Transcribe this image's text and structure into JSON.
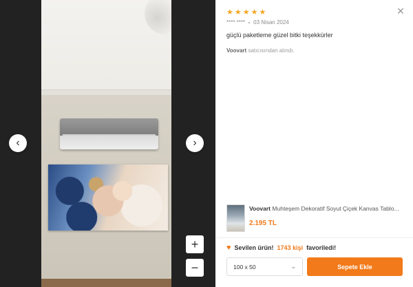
{
  "review": {
    "rating": 5,
    "stars": [
      "★",
      "★",
      "★",
      "★",
      "★"
    ],
    "author": "**** ****",
    "date": "03 Nisan 2024",
    "comment": "güçlü paketleme güzel bitki teşekkürler",
    "seller_name": "Voovart",
    "seller_suffix": "satıcısından alındı."
  },
  "viewer": {
    "prev_icon": "‹",
    "next_icon": "›",
    "zoom_in_icon": "+",
    "zoom_out_icon": "−"
  },
  "close_icon": "✕",
  "product": {
    "brand": "Voovart",
    "name": "Muhteşem Dekoratif Soyut Çiçek Kanvas Tablo...",
    "price": "2.195 TL"
  },
  "favorite": {
    "prefix": "Sevilen ürün!",
    "count": "1743 kişi",
    "suffix": "favoriledi!"
  },
  "size_select": {
    "value": "100 x 50"
  },
  "add_to_cart_label": "Sepete Ekle",
  "colors": {
    "accent": "#f27a1a",
    "star": "#f5a623"
  }
}
